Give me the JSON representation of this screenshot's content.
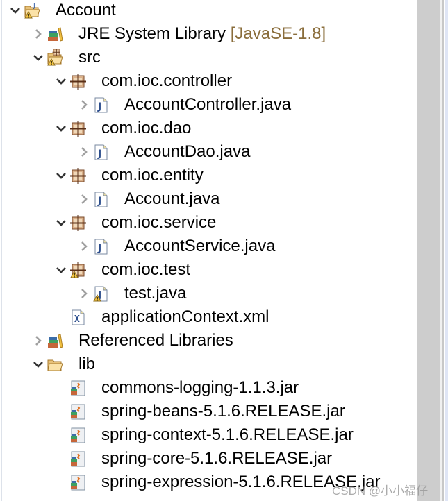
{
  "tree": [
    {
      "label": "Account",
      "level": 0,
      "chevron": "down",
      "icon": "project-folder-warning-icon"
    },
    {
      "label": "JRE System Library",
      "decoration": "[JavaSE-1.8]",
      "level": 1,
      "chevron": "right",
      "icon": "library-icon"
    },
    {
      "label": "src",
      "level": 1,
      "chevron": "down",
      "icon": "source-folder-warning-icon"
    },
    {
      "label": "com.ioc.controller",
      "level": 2,
      "chevron": "down",
      "icon": "package-icon"
    },
    {
      "label": "AccountController.java",
      "level": 3,
      "chevron": "right",
      "icon": "java-file-icon"
    },
    {
      "label": "com.ioc.dao",
      "level": 2,
      "chevron": "down",
      "icon": "package-icon"
    },
    {
      "label": "AccountDao.java",
      "level": 3,
      "chevron": "right",
      "icon": "java-file-icon"
    },
    {
      "label": "com.ioc.entity",
      "level": 2,
      "chevron": "down",
      "icon": "package-icon"
    },
    {
      "label": "Account.java",
      "level": 3,
      "chevron": "right",
      "icon": "java-file-icon"
    },
    {
      "label": "com.ioc.service",
      "level": 2,
      "chevron": "down",
      "icon": "package-icon"
    },
    {
      "label": "AccountService.java",
      "level": 3,
      "chevron": "right",
      "icon": "java-file-icon"
    },
    {
      "label": "com.ioc.test",
      "level": 2,
      "chevron": "down",
      "icon": "package-warning-icon"
    },
    {
      "label": "test.java",
      "level": 3,
      "chevron": "right",
      "icon": "java-file-warning-icon"
    },
    {
      "label": "applicationContext.xml",
      "level": 2,
      "chevron": "none",
      "icon": "xml-file-icon"
    },
    {
      "label": "Referenced Libraries",
      "level": 1,
      "chevron": "right",
      "icon": "library-icon"
    },
    {
      "label": "lib",
      "level": 1,
      "chevron": "down",
      "icon": "folder-open-icon"
    },
    {
      "label": "commons-logging-1.1.3.jar",
      "level": 2,
      "chevron": "none",
      "icon": "jar-file-icon"
    },
    {
      "label": "spring-beans-5.1.6.RELEASE.jar",
      "level": 2,
      "chevron": "none",
      "icon": "jar-file-icon"
    },
    {
      "label": "spring-context-5.1.6.RELEASE.jar",
      "level": 2,
      "chevron": "none",
      "icon": "jar-file-icon"
    },
    {
      "label": "spring-core-5.1.6.RELEASE.jar",
      "level": 2,
      "chevron": "none",
      "icon": "jar-file-icon"
    },
    {
      "label": "spring-expression-5.1.6.RELEASE.jar",
      "level": 2,
      "chevron": "none",
      "icon": "jar-file-icon"
    }
  ],
  "watermark": "CSDN @小小福仔",
  "colors": {
    "decoration": "#8a6d3b",
    "scrollbar": "#cdcdcd",
    "chevron_down": "#333333",
    "chevron_right": "#a0a0a0"
  }
}
